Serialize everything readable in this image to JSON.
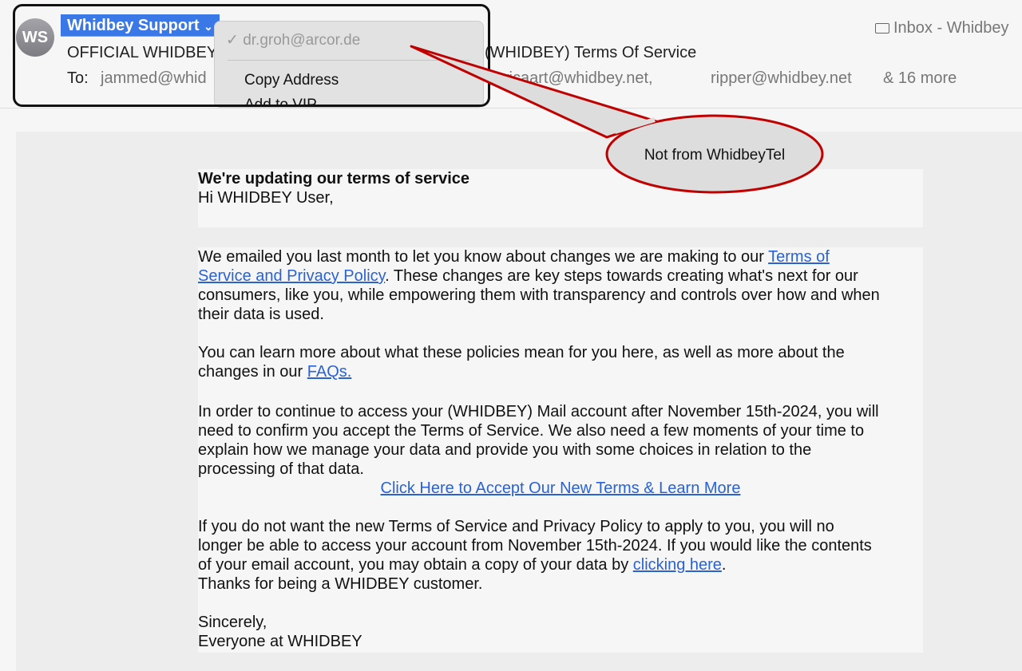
{
  "header": {
    "avatar_initials": "WS",
    "sender": "Whidbey Support",
    "sender_chevron": "⌄",
    "subject_start": "OFFICIAL WHIDBEY",
    "subject_end": "(WHIDBEY) Terms Of Service",
    "to_label": "To:",
    "to_first": "jammed@whid",
    "to_others": [
      ", wicaart@whidbey.net,",
      "ripper@whidbey.net"
    ],
    "to_more": "& 16 more",
    "mailbox": "Inbox - Whidbey",
    "mailbox_icon": "folder-icon"
  },
  "context_menu": {
    "checkmark": "✓",
    "address": "dr.groh@arcor.de",
    "items": [
      "Copy Address",
      "Add to VIP"
    ]
  },
  "callout": {
    "text": "Not from WhidbeyTel",
    "stroke": "#c00000",
    "fill": "#dddddd"
  },
  "email": {
    "heading": "We're updating our terms of service",
    "greeting": "Hi WHIDBEY User,",
    "p1": [
      "We emailed you last month to let you know about changes we are making to our ",
      "Terms of",
      "Service and Privacy Policy",
      ". These changes are key steps towards creating what's next for our",
      "consumers, like you, while empowering them with transparency and controls over how and when",
      "their data is used."
    ],
    "p2": [
      "You can learn more about what these policies mean for you here, as well as more about the",
      "changes in our ",
      "FAQs."
    ],
    "p3": [
      "In order to continue to access your (WHIDBEY) Mail account after November 15th-2024, you will",
      "need to confirm you accept the Terms of Service. We also need a few moments of your time to",
      "explain how we manage your data and provide you with some choices in relation to the",
      "processing of that data."
    ],
    "cta": "Click Here to Accept Our New Terms & Learn More",
    "p4": [
      "If you do not want the new Terms of Service and Privacy Policy to apply to  you, you will no",
      "longer be able to access your account from November 15th-2024. If you would like the contents",
      "of your email account, you may obtain a copy of your data by ",
      "clicking here",
      ".",
      "Thanks for being a WHIDBEY customer."
    ],
    "closing": "Sincerely,",
    "signature": "Everyone at WHIDBEY"
  }
}
